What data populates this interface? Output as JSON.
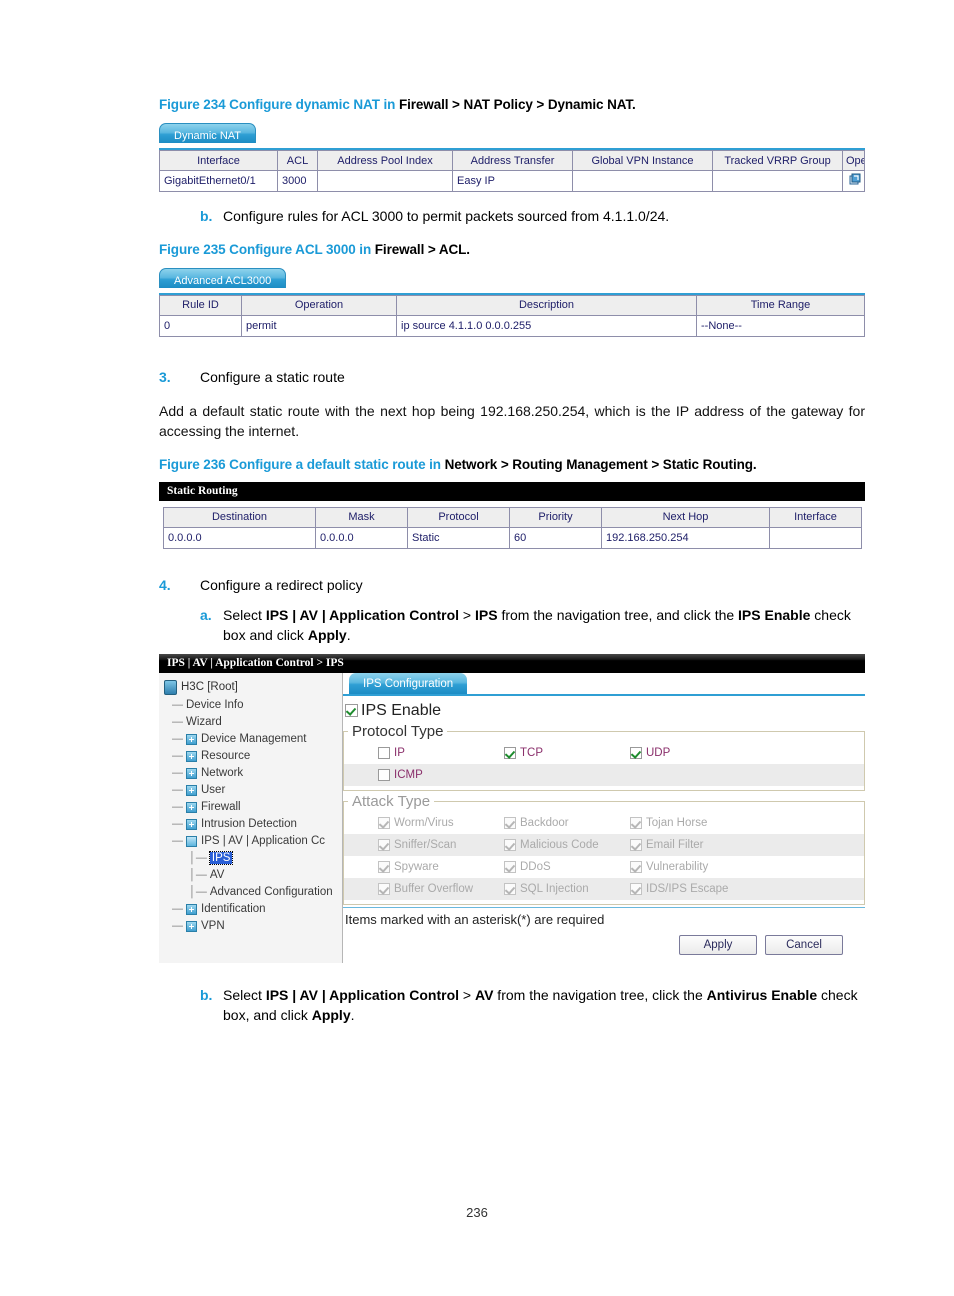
{
  "page": {
    "number": "236"
  },
  "figure234": {
    "caption_prefix": "Figure 234 Configure dynamic NAT in ",
    "caption_path": "Firewall > NAT Policy > Dynamic NAT.",
    "tab_label": "Dynamic NAT",
    "columns": [
      "Interface",
      "ACL",
      "Address Pool Index",
      "Address Transfer",
      "Global VPN Instance",
      "Tracked VRRP Group",
      "Operation"
    ],
    "rows": [
      {
        "interface": "GigabitEthernet0/1",
        "acl": "3000",
        "address_pool_index": "",
        "address_transfer": "Easy IP",
        "global_vpn_instance": "",
        "tracked_vrrp_group": "",
        "operation_icons": [
          "edit-icon",
          "delete-icon"
        ]
      }
    ]
  },
  "step_b1": {
    "marker": "b.",
    "text": "Configure rules for ACL 3000 to permit packets sourced from 4.1.1.0/24."
  },
  "figure235": {
    "caption_prefix": "Figure 235 Configure ACL 3000 in ",
    "caption_path": "Firewall > ACL.",
    "tab_label": "Advanced ACL3000",
    "columns": [
      "Rule ID",
      "Operation",
      "Description",
      "Time Range"
    ],
    "rows": [
      {
        "rule_id": "0",
        "operation": "permit",
        "description": "ip source 4.1.1.0 0.0.0.255",
        "time_range": "--None--"
      }
    ]
  },
  "step3": {
    "marker": "3.",
    "title": "Configure a static route",
    "paragraph": "Add a default static route with the next hop being 192.168.250.254, which is the IP address of the gateway for accessing the internet."
  },
  "figure236": {
    "caption_prefix": "Figure 236 Configure a default static route in ",
    "caption_path": "Network > Routing Management > Static Routing.",
    "window_title": "Static Routing",
    "columns": [
      "Destination",
      "Mask",
      "Protocol",
      "Priority",
      "Next Hop",
      "Interface"
    ],
    "rows": [
      {
        "destination": "0.0.0.0",
        "mask": "0.0.0.0",
        "protocol": "Static",
        "priority": "60",
        "next_hop": "192.168.250.254",
        "interface": ""
      }
    ]
  },
  "step4": {
    "marker": "4.",
    "title": "Configure a redirect policy"
  },
  "step4a": {
    "marker": "a.",
    "part1": "Select ",
    "bold1": "IPS | AV | Application Control",
    "part2": " > ",
    "bold2": "IPS",
    "part3": " from the navigation tree, and click the ",
    "bold3": "IPS Enable",
    "part4": " check box and click ",
    "bold4": "Apply",
    "part5": "."
  },
  "ips_window": {
    "breadcrumb": "IPS | AV | Application Control > IPS",
    "tree": {
      "root": "H3C [Root]",
      "items": [
        {
          "label": "Device Info",
          "icon": "none",
          "level": 1,
          "selected": false
        },
        {
          "label": "Wizard",
          "icon": "none",
          "level": 1,
          "selected": false
        },
        {
          "label": "Device Management",
          "icon": "folder-closed-icon",
          "level": 1,
          "selected": false
        },
        {
          "label": "Resource",
          "icon": "folder-closed-icon",
          "level": 1,
          "selected": false
        },
        {
          "label": "Network",
          "icon": "folder-closed-icon",
          "level": 1,
          "selected": false
        },
        {
          "label": "User",
          "icon": "folder-closed-icon",
          "level": 1,
          "selected": false
        },
        {
          "label": "Firewall",
          "icon": "folder-closed-icon",
          "level": 1,
          "selected": false
        },
        {
          "label": "Intrusion Detection",
          "icon": "folder-closed-icon",
          "level": 1,
          "selected": false
        },
        {
          "label": "IPS | AV | Application Cc",
          "icon": "folder-open-icon",
          "level": 1,
          "selected": false
        },
        {
          "label": "IPS",
          "icon": "none",
          "level": 2,
          "selected": true
        },
        {
          "label": "AV",
          "icon": "none",
          "level": 2,
          "selected": false
        },
        {
          "label": "Advanced Configuration",
          "icon": "none",
          "level": 2,
          "selected": false
        },
        {
          "label": "Identification",
          "icon": "folder-closed-icon",
          "level": 1,
          "selected": false
        },
        {
          "label": "VPN",
          "icon": "folder-closed-icon",
          "level": 1,
          "selected": false
        }
      ]
    },
    "tab_label": "IPS Configuration",
    "ips_enable": {
      "label": "IPS Enable",
      "checked": true
    },
    "protocol_type": {
      "legend": "Protocol Type",
      "items": [
        {
          "label": "IP",
          "checked": false,
          "disabled": false
        },
        {
          "label": "TCP",
          "checked": true,
          "disabled": false
        },
        {
          "label": "UDP",
          "checked": true,
          "disabled": false
        },
        {
          "label": "ICMP",
          "checked": false,
          "disabled": false
        }
      ]
    },
    "attack_type": {
      "legend": "Attack Type",
      "items": [
        {
          "label": "Worm/Virus",
          "checked": true,
          "disabled": true
        },
        {
          "label": "Backdoor",
          "checked": true,
          "disabled": true
        },
        {
          "label": "Tojan Horse",
          "checked": true,
          "disabled": true
        },
        {
          "label": "Sniffer/Scan",
          "checked": true,
          "disabled": true
        },
        {
          "label": "Malicious Code",
          "checked": true,
          "disabled": true
        },
        {
          "label": "Email Filter",
          "checked": true,
          "disabled": true
        },
        {
          "label": "Spyware",
          "checked": true,
          "disabled": true
        },
        {
          "label": "DDoS",
          "checked": true,
          "disabled": true
        },
        {
          "label": "Vulnerability",
          "checked": true,
          "disabled": true
        },
        {
          "label": "Buffer Overflow",
          "checked": true,
          "disabled": true
        },
        {
          "label": "SQL Injection",
          "checked": true,
          "disabled": true
        },
        {
          "label": "IDS/IPS Escape",
          "checked": true,
          "disabled": true
        }
      ]
    },
    "required_note": "Items marked with an asterisk(*) are required",
    "apply_label": "Apply",
    "cancel_label": "Cancel"
  },
  "step4b": {
    "marker": "b.",
    "part1": "Select ",
    "bold1": "IPS | AV | Application Control",
    "part2": " > ",
    "bold2": "AV",
    "part3": " from the navigation tree, click the ",
    "bold3": "Antivirus Enable",
    "part4": " check box, and click ",
    "bold4": "Apply",
    "part5": "."
  },
  "colors": {
    "caption_blue": "#1a9ad7",
    "tab_blue": "#2f9fd4",
    "grid_text": "#20206a",
    "checkbox_label": "#8a2f6b",
    "check_green": "#1e8c2e"
  }
}
